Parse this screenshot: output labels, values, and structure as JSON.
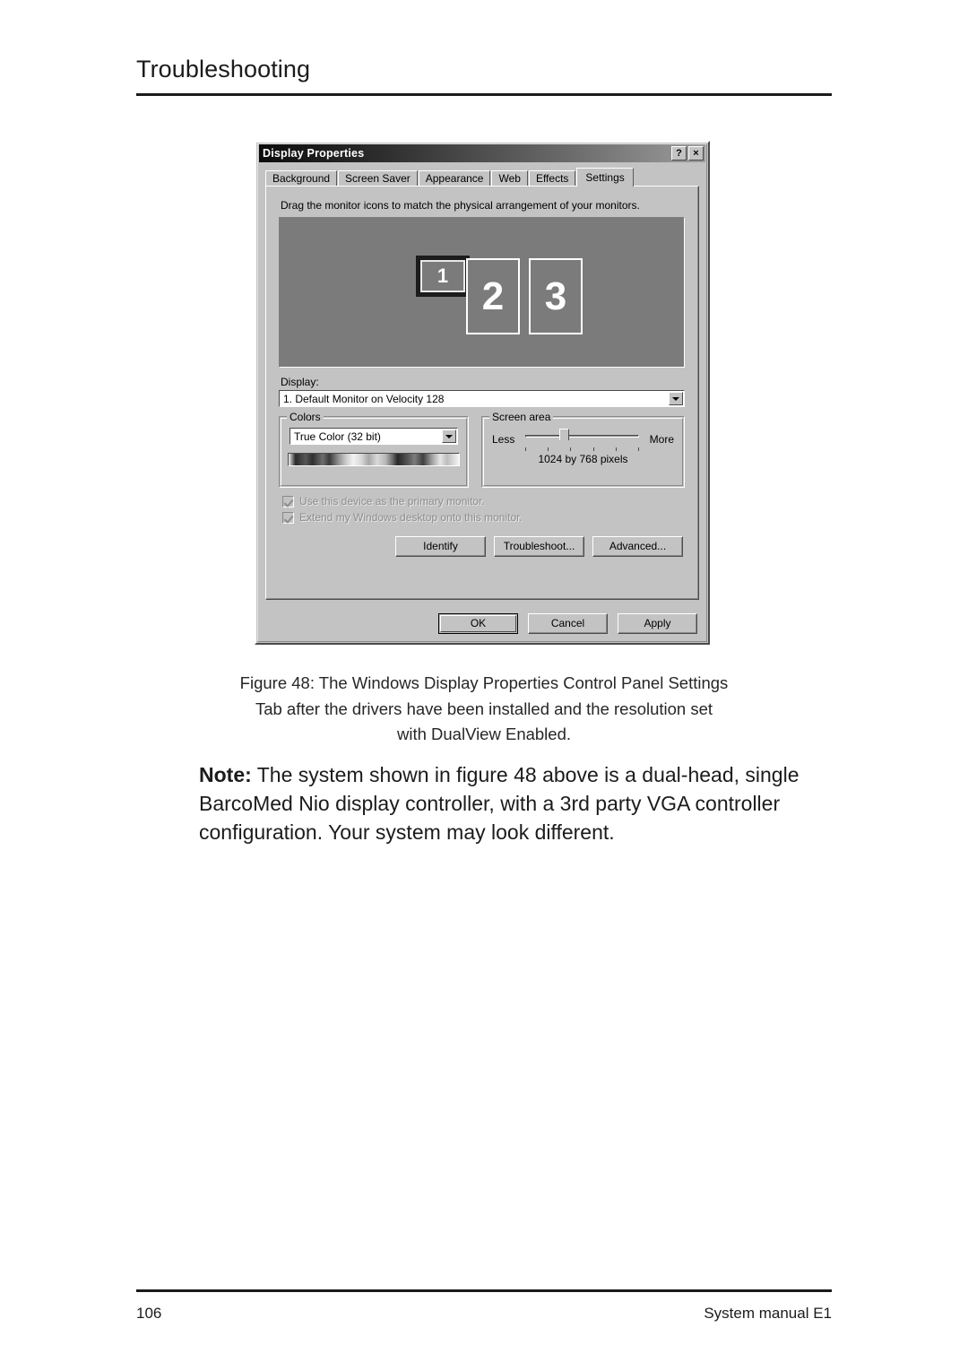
{
  "page": {
    "header_title": "Troubleshooting",
    "footer_page_number": "106",
    "footer_right": "System manual E1"
  },
  "figure": {
    "caption_line1": "Figure 48: The Windows Display Properties Control Panel Settings",
    "caption_line2": "Tab after the drivers have been installed and the resolution set",
    "caption_line3": "with DualView Enabled."
  },
  "note": {
    "label": "Note:",
    "text": " The system shown in figure 48 above is a dual-head, single BarcoMed Nio display controller, with a 3rd party VGA controller configuration. Your system may look different."
  },
  "dialog": {
    "title": "Display Properties",
    "help_button": "?",
    "close_button": "×",
    "tabs": [
      {
        "label": "Background",
        "active": false
      },
      {
        "label": "Screen Saver",
        "active": false
      },
      {
        "label": "Appearance",
        "active": false
      },
      {
        "label": "Web",
        "active": false
      },
      {
        "label": "Effects",
        "active": false
      },
      {
        "label": "Settings",
        "active": true
      }
    ],
    "hint": "Drag the monitor icons to match the physical arrangement of your monitors.",
    "monitors": [
      {
        "number": "1",
        "selected": true,
        "orientation": "landscape"
      },
      {
        "number": "2",
        "selected": false,
        "orientation": "portrait"
      },
      {
        "number": "3",
        "selected": false,
        "orientation": "portrait"
      }
    ],
    "display": {
      "label": "Display:",
      "value": "1. Default Monitor on Velocity 128"
    },
    "colors": {
      "group_title": "Colors",
      "value": "True Color (32 bit)"
    },
    "screen_area": {
      "group_title": "Screen area",
      "less_label": "Less",
      "more_label": "More",
      "readout": "1024 by 768 pixels",
      "slider_position_percent": 31,
      "tick_count": 6
    },
    "checkboxes": [
      {
        "label": "Use this device as the primary monitor.",
        "checked": true,
        "disabled": true
      },
      {
        "label": "Extend my Windows desktop onto this monitor.",
        "checked": true,
        "disabled": true
      }
    ],
    "action_buttons": [
      {
        "label": "Identify"
      },
      {
        "label": "Troubleshoot..."
      },
      {
        "label": "Advanced..."
      }
    ],
    "dialog_buttons": [
      {
        "label": "OK",
        "default": true
      },
      {
        "label": "Cancel",
        "default": false
      },
      {
        "label": "Apply",
        "default": false
      }
    ]
  },
  "colors": {
    "dialog_face": "#c3c3c3",
    "titlebar_dark": "#0c0c0c",
    "preview_bg": "#7b7b7b",
    "disabled_text": "#8d8d8d"
  }
}
